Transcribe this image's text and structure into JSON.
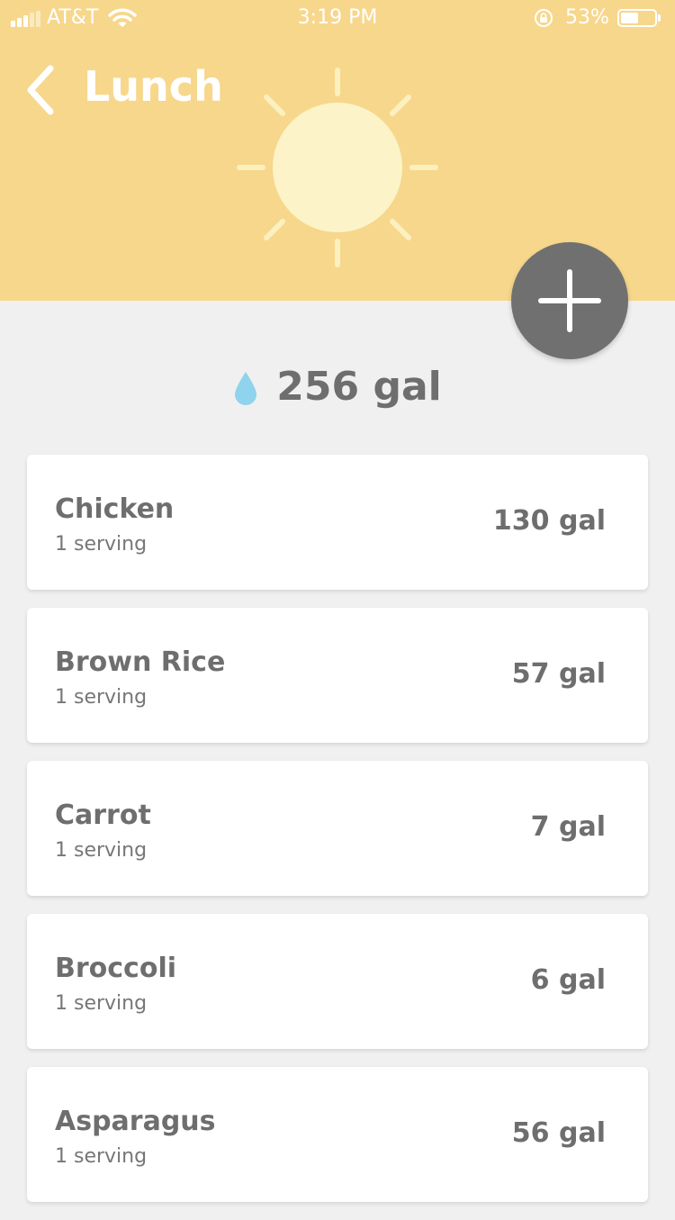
{
  "status_bar": {
    "carrier": "AT&T",
    "time": "3:19 PM",
    "battery_percent": "53%",
    "battery_level": 0.53,
    "signal_bars_filled": 3,
    "signal_bars_total": 5
  },
  "header": {
    "title": "Lunch",
    "background_color": "#f7d78c",
    "icon": "sun-icon"
  },
  "add_button": {
    "icon": "plus-icon",
    "color": "#707070"
  },
  "total": {
    "icon": "water-drop-icon",
    "value": "256 gal",
    "drop_color": "#8fd3ec"
  },
  "items": [
    {
      "name": "Chicken",
      "serving": "1 serving",
      "amount": "130 gal"
    },
    {
      "name": "Brown Rice",
      "serving": "1 serving",
      "amount": "57 gal"
    },
    {
      "name": "Carrot",
      "serving": "1 serving",
      "amount": "7 gal"
    },
    {
      "name": "Broccoli",
      "serving": "1 serving",
      "amount": "6 gal"
    },
    {
      "name": "Asparagus",
      "serving": "1 serving",
      "amount": "56 gal"
    }
  ]
}
